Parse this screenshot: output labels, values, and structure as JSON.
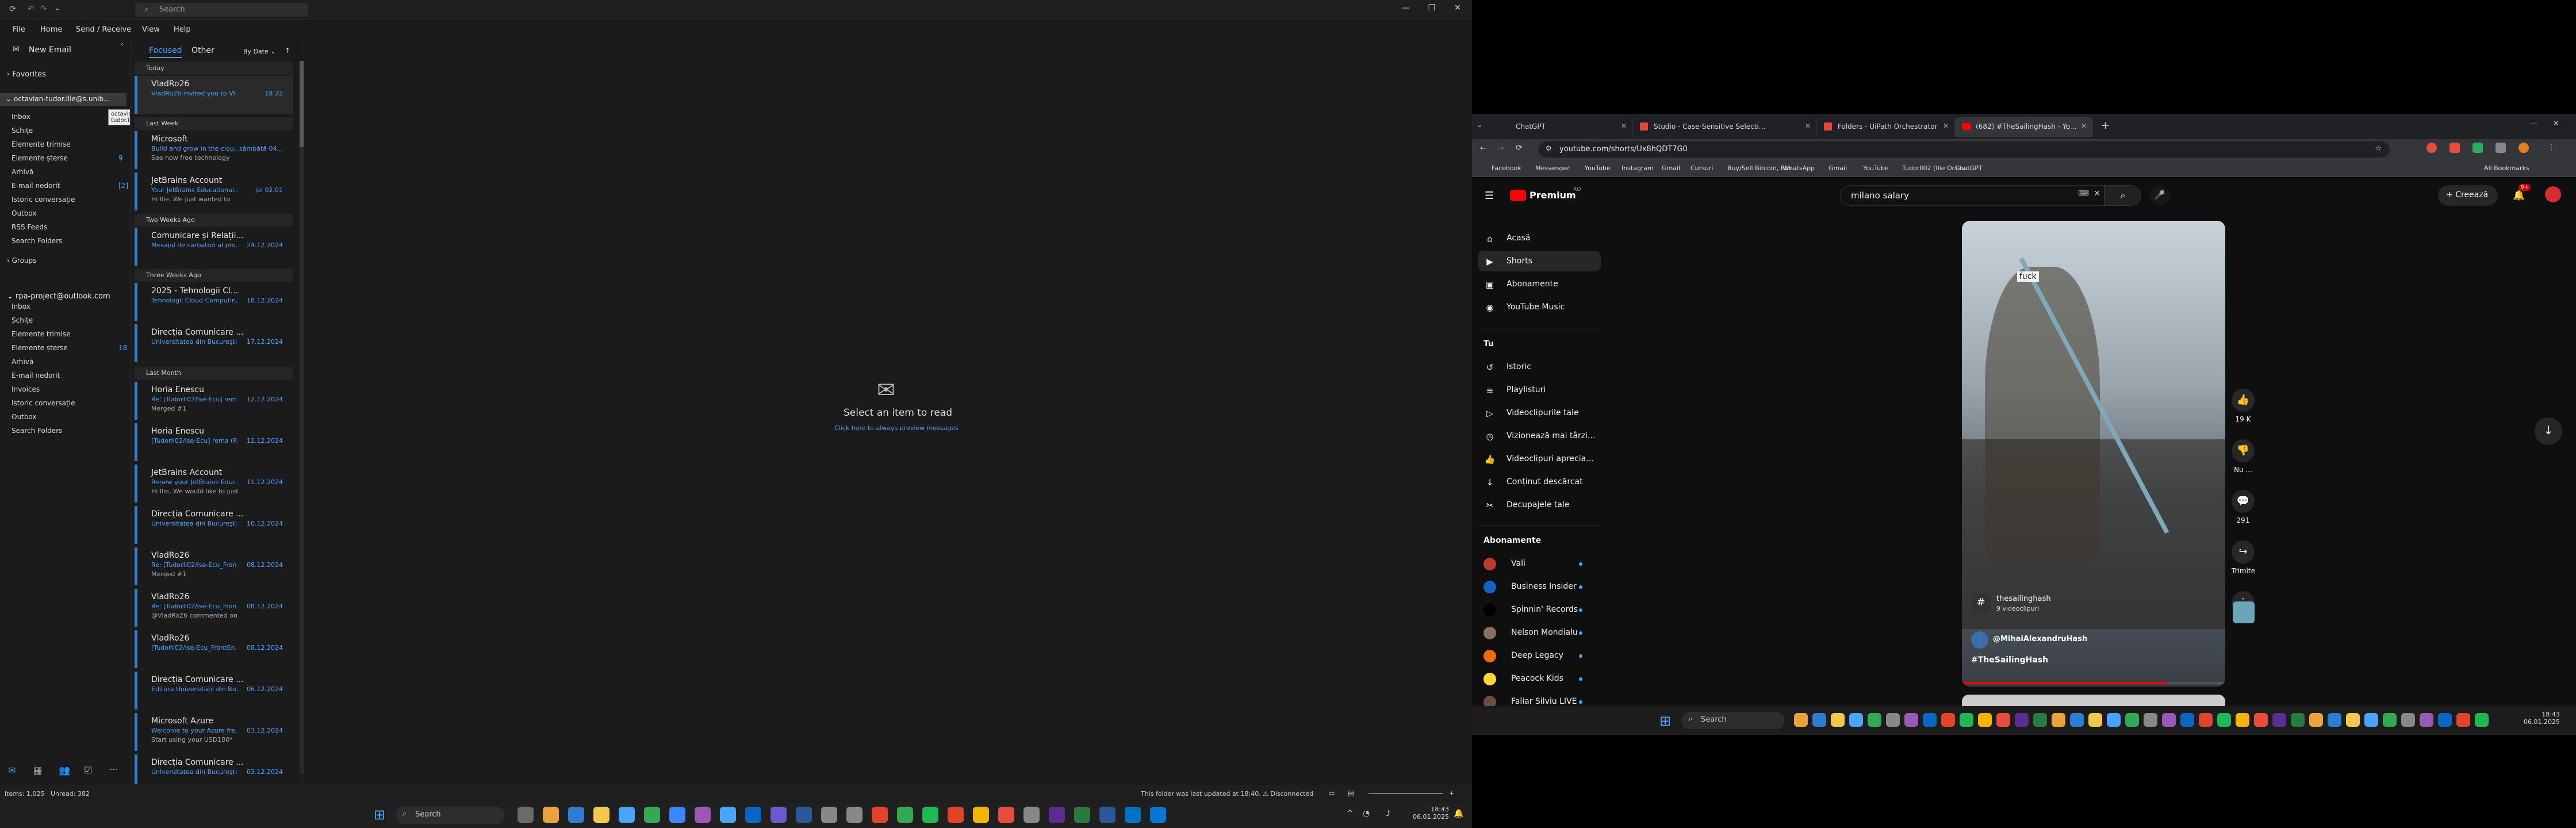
{
  "outlook": {
    "search_placeholder": "Search",
    "menu": [
      "File",
      "Home",
      "Send / Receive",
      "View",
      "Help"
    ],
    "new_email": "New Email",
    "favorites": "Favorites",
    "account1": {
      "name": "octavian-tudor.ilie@s.unib...",
      "tooltip": "octavian-tudor.ilie@s.unibuc.ro",
      "folders": [
        {
          "label": "Inbox",
          "count": ""
        },
        {
          "label": "Schițe",
          "count": ""
        },
        {
          "label": "Elemente trimise",
          "count": ""
        },
        {
          "label": "Elemente șterse",
          "count": "9"
        },
        {
          "label": "Arhivă",
          "count": ""
        },
        {
          "label": "E-mail nedorit",
          "count": "[2]"
        },
        {
          "label": "Istoric conversație",
          "count": ""
        },
        {
          "label": "Outbox",
          "count": ""
        },
        {
          "label": "RSS Feeds",
          "count": ""
        },
        {
          "label": "Search Folders",
          "count": ""
        }
      ],
      "groups": "Groups"
    },
    "account2": {
      "name": "rpa-project@outlook.com",
      "folders": [
        {
          "label": "Inbox",
          "count": ""
        },
        {
          "label": "Schițe",
          "count": ""
        },
        {
          "label": "Elemente trimise",
          "count": ""
        },
        {
          "label": "Elemente șterse",
          "count": "18"
        },
        {
          "label": "Arhivă",
          "count": ""
        },
        {
          "label": "E-mail nedorit",
          "count": ""
        },
        {
          "label": "Invoices",
          "count": ""
        },
        {
          "label": "Istoric conversație",
          "count": ""
        },
        {
          "label": "Outbox",
          "count": ""
        },
        {
          "label": "Search Folders",
          "count": ""
        }
      ]
    },
    "tabs": {
      "focused": "Focused",
      "other": "Other"
    },
    "sort": "By Date",
    "groups": {
      "today": "Today",
      "last_week": "Last Week",
      "two_weeks": "Two Weeks Ago",
      "three_weeks": "Three Weeks Ago",
      "last_month": "Last Month"
    },
    "mails": [
      {
        "from": "VladRo26",
        "subj": "VladRo26 invited you to Vl...",
        "date": "18:22",
        "prev": ""
      },
      {
        "from": "Microsoft",
        "subj": "Build and grow in the clou...",
        "date": "sâmbătă 04...",
        "prev": "See how free technology"
      },
      {
        "from": "JetBrains Account",
        "subj": "Your JetBrains Educational...",
        "date": "joi 02.01",
        "prev": "Hi Ilie, We just wanted to"
      },
      {
        "from": "Comunicare și Relații...",
        "subj": "Mesajul de sărbători al pro...",
        "date": "24.12.2024",
        "prev": ""
      },
      {
        "from": "2025 - Tehnologii Cl...",
        "subj": "Tehnologii Cloud Computin...",
        "date": "18.12.2024",
        "prev": ""
      },
      {
        "from": "Direcția Comunicare ...",
        "subj": "Universitatea din Bucureşti...",
        "date": "17.12.2024",
        "prev": ""
      },
      {
        "from": "Horia Enescu",
        "subj": "Re: [TudorIl02/Ise-Ecu] rema...",
        "date": "12.12.2024",
        "prev": "Merged #1"
      },
      {
        "from": "Horia Enescu",
        "subj": "[TudorIl02/Ise-Ecu] rema (P...",
        "date": "12.12.2024",
        "prev": ""
      },
      {
        "from": "JetBrains Account",
        "subj": "Renew your JetBrains Educ...",
        "date": "11.12.2024",
        "prev": "Hi Ilie, We would like to just"
      },
      {
        "from": "Direcția Comunicare ...",
        "subj": "Universitatea din Bucureşti...",
        "date": "10.12.2024",
        "prev": ""
      },
      {
        "from": "VladRo26",
        "subj": "Re: [TudorIl02/Ise-Ecu_Fron...",
        "date": "08.12.2024",
        "prev": "Merged #1"
      },
      {
        "from": "VladRo26",
        "subj": "Re: [TudorIl02/Ise-Ecu_Fron...",
        "date": "08.12.2024",
        "prev": "@VladRo26 commented on"
      },
      {
        "from": "VladRo26",
        "subj": "[TudorIl02/Ise-Ecu_FrontEn...",
        "date": "08.12.2024",
        "prev": ""
      },
      {
        "from": "Direcția Comunicare ...",
        "subj": "Editura Universității din Bu...",
        "date": "06.12.2024",
        "prev": ""
      },
      {
        "from": "Microsoft Azure",
        "subj": "Welcome to your Azure fre...",
        "date": "03.12.2024",
        "prev": "Start using your USD100*"
      },
      {
        "from": "Direcția Comunicare ...",
        "subj": "Universitatea din Bucureşti...",
        "date": "03.12.2024",
        "prev": ""
      }
    ],
    "reading": {
      "title": "Select an item to read",
      "link": "Click here to always preview messages"
    },
    "status": {
      "items": "Items: 1,025",
      "unread": "Unread: 382",
      "updated": "This folder was last updated at 18:40.",
      "conn": "Disconnected"
    },
    "taskbar": {
      "search": "Search",
      "time": "18:43",
      "date": "06.01.2025"
    }
  },
  "chrome": {
    "tabs": [
      {
        "label": "ChatGPT"
      },
      {
        "label": "Studio - Case-Sensitive Selecti..."
      },
      {
        "label": "Folders - UiPath Orchestrator"
      },
      {
        "label": "(682) #TheSailingHash - Yo..."
      }
    ],
    "url": "youtube.com/shorts/Ux8hQDT7G0",
    "bookmarks": [
      "Facebook",
      "Messenger",
      "YouTube",
      "Instagram",
      "Gmail",
      "Cursuri",
      "Buy/Sell Bitcoin, Eth...",
      "WhatsApp",
      "Gmail",
      "YouTube",
      "TudorIl02 (Ilie Octav...",
      "ChatGPT",
      "All Bookmarks"
    ],
    "youtube": {
      "premium": "Premium",
      "badge": "RO",
      "search_value": "milano salary",
      "create": "Creează",
      "notif": "9+",
      "nav": [
        "Acasă",
        "Shorts",
        "Abonamente",
        "YouTube Music"
      ],
      "you": "Tu",
      "you_items": [
        "Istoric",
        "Playlisturi",
        "Videoclipurile tale",
        "Vizionează mai târzi...",
        "Videoclipuri aprecia...",
        "Conținut descărcat",
        "Decupajele tale"
      ],
      "subs_title": "Abonamente",
      "subs": [
        "Vali",
        "Business Insider",
        "Spinnin' Records",
        "Nelson Mondialu",
        "Deep Legacy",
        "Peacock Kids",
        "Faliar Silviu LIVE"
      ],
      "video": {
        "caption": "fuck",
        "hashtag": "thesailinghash",
        "videos": "9 videoclipuri",
        "channel": "@MihaiAlexandruHash",
        "title": "#TheSailingHash"
      },
      "actions": [
        {
          "icon": "like-icon",
          "label": "19 K"
        },
        {
          "icon": "dislike-icon",
          "label": "Nu ..."
        },
        {
          "icon": "comment-icon",
          "label": "291"
        },
        {
          "icon": "share-icon",
          "label": "Trimite"
        },
        {
          "icon": "more-icon",
          "label": ""
        }
      ]
    }
  },
  "taskbar2": {
    "search": "Search",
    "time": "18:43",
    "date": "06.01.2025"
  }
}
